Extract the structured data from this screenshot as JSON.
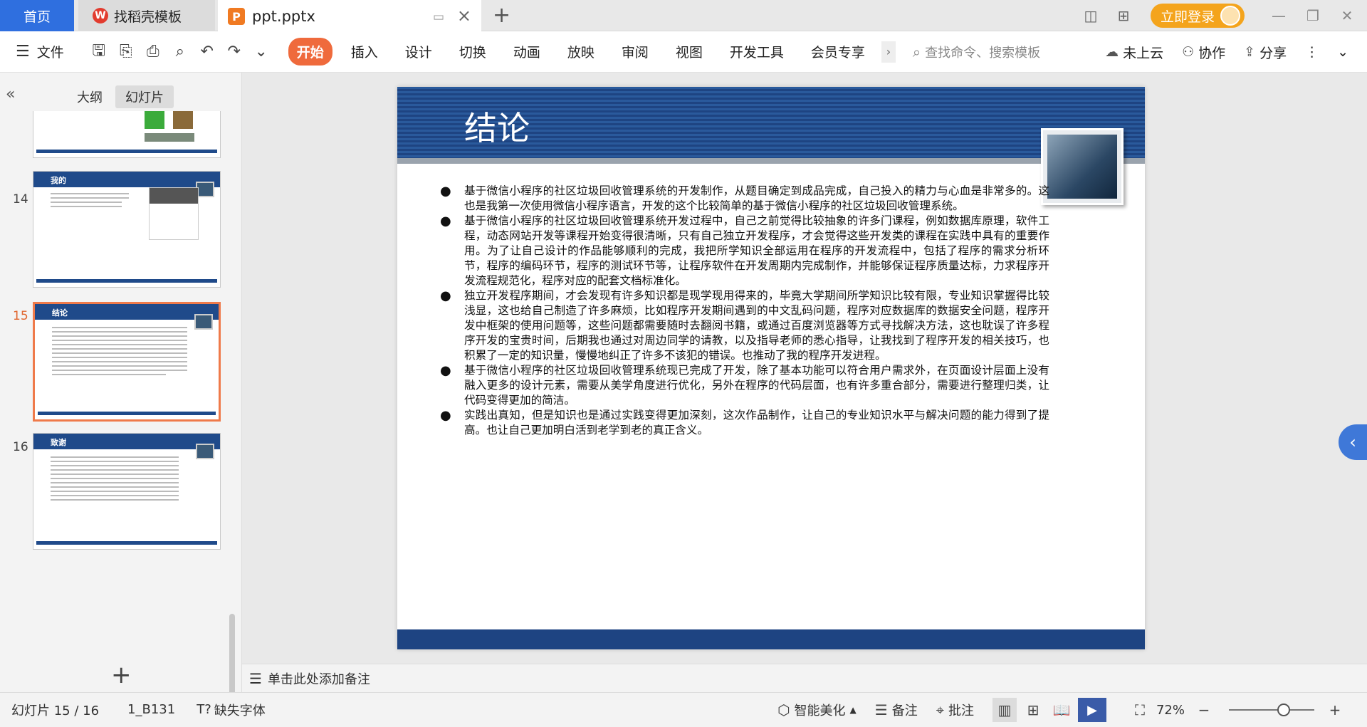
{
  "tabs": {
    "home": "首页",
    "template": "找稻壳模板",
    "template_logo": "W",
    "document": "ppt.pptx",
    "doc_logo": "P"
  },
  "topbar": {
    "login": "立即登录"
  },
  "ribbon": {
    "file": "文件",
    "tabs": [
      "开始",
      "插入",
      "设计",
      "切换",
      "动画",
      "放映",
      "审阅",
      "视图",
      "开发工具",
      "会员专享"
    ],
    "search_placeholder": "查找命令、搜索模板",
    "cloud": "未上云",
    "collab": "协作",
    "share": "分享"
  },
  "panel": {
    "tab_outline": "大纲",
    "tab_slides": "幻灯片",
    "thumbs": [
      {
        "num": "14",
        "title": "我的"
      },
      {
        "num": "15",
        "title": "结论"
      },
      {
        "num": "16",
        "title": "致谢"
      }
    ]
  },
  "slide": {
    "title": "结论",
    "bullets": [
      "基于微信小程序的社区垃圾回收管理系统的开发制作，从题目确定到成品完成，自己投入的精力与心血是非常多的。这也是我第一次使用微信小程序语言，开发的这个比较简单的基于微信小程序的社区垃圾回收管理系统。",
      "基于微信小程序的社区垃圾回收管理系统开发过程中，自己之前觉得比较抽象的许多门课程，例如数据库原理，软件工程，动态网站开发等课程开始变得很清晰，只有自己独立开发程序，才会觉得这些开发类的课程在实践中具有的重要作用。为了让自己设计的作品能够顺利的完成，我把所学知识全部运用在程序的开发流程中，包括了程序的需求分析环节，程序的编码环节，程序的测试环节等，让程序软件在开发周期内完成制作，并能够保证程序质量达标，力求程序开发流程规范化，程序对应的配套文档标准化。",
      "独立开发程序期间，才会发现有许多知识都是现学现用得来的，毕竟大学期间所学知识比较有限，专业知识掌握得比较浅显，这也给自己制造了许多麻烦，比如程序开发期间遇到的中文乱码问题，程序对应数据库的数据安全问题，程序开发中框架的使用问题等，这些问题都需要随时去翻阅书籍，或通过百度浏览器等方式寻找解决方法，这也耽误了许多程序开发的宝贵时间，后期我也通过对周边同学的请教，以及指导老师的悉心指导，让我找到了程序开发的相关技巧，也积累了一定的知识量，慢慢地纠正了许多不该犯的错误。也推动了我的程序开发进程。",
      "基于微信小程序的社区垃圾回收管理系统现已完成了开发，除了基本功能可以符合用户需求外，在页面设计层面上没有融入更多的设计元素，需要从美学角度进行优化，另外在程序的代码层面，也有许多重合部分，需要进行整理归类，让代码变得更加的简洁。",
      "实践出真知，但是知识也是通过实践变得更加深刻，这次作品制作，让自己的专业知识水平与解决问题的能力得到了提高。也让自己更加明白活到老学到老的真正含义。"
    ]
  },
  "notes": {
    "placeholder": "单击此处添加备注"
  },
  "status": {
    "slide_counter": "幻灯片 15 / 16",
    "theme": "1_B131",
    "missing_font": "缺失字体",
    "beautify": "智能美化",
    "notes": "备注",
    "comment": "批注",
    "zoom": "72%"
  },
  "colors": {
    "accent": "#ef6a3c",
    "header_blue": "#1e4482",
    "home_tab": "#2f6fdf"
  }
}
